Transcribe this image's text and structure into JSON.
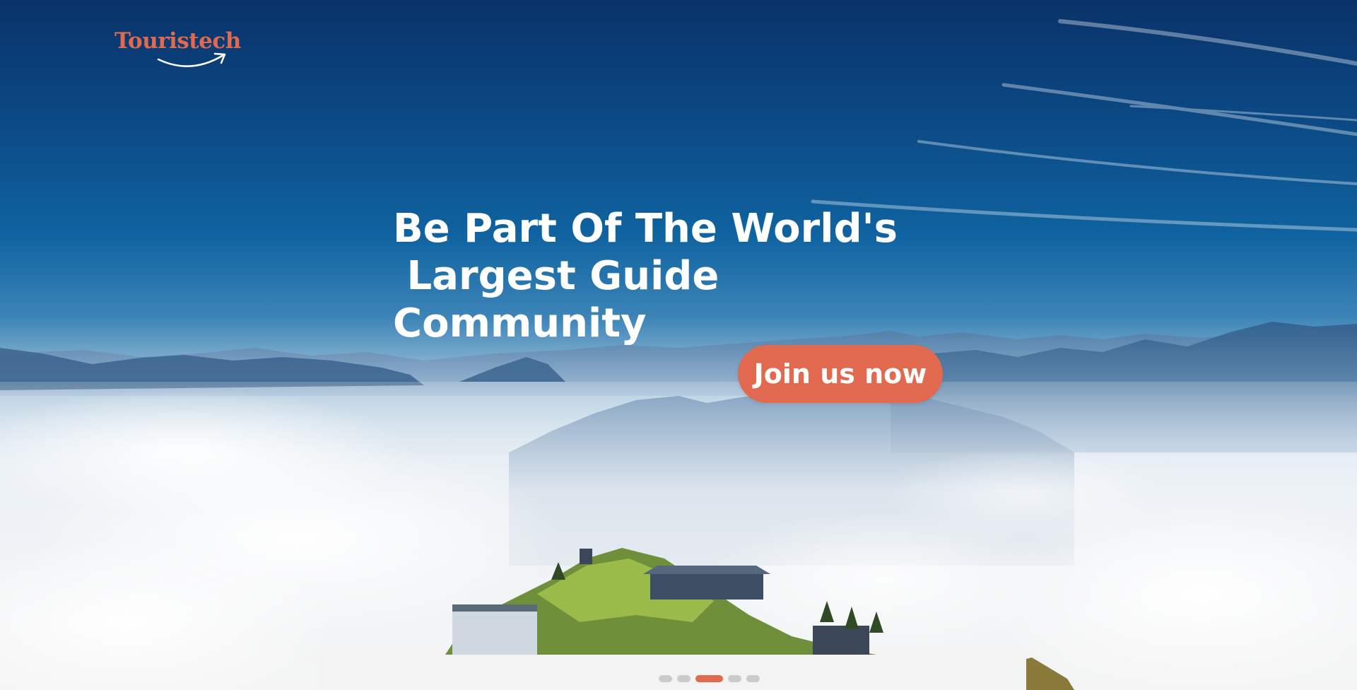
{
  "brand": {
    "name": "Touristech",
    "accent_color": "#e0694f"
  },
  "hero": {
    "headline_lines": [
      "Be Part Of The World's",
      " Largest Guide",
      "Community"
    ],
    "cta_label": "Join us now",
    "background": "mountain-above-clouds-photo"
  },
  "carousel": {
    "slide_count": 5,
    "active_index": 2
  },
  "colors": {
    "sky_top": "#0a3269",
    "sky_mid": "#0f63a0",
    "cloud": "#f4f5f6",
    "text": "#ffffff",
    "dot_inactive": "#cbcbcb"
  }
}
